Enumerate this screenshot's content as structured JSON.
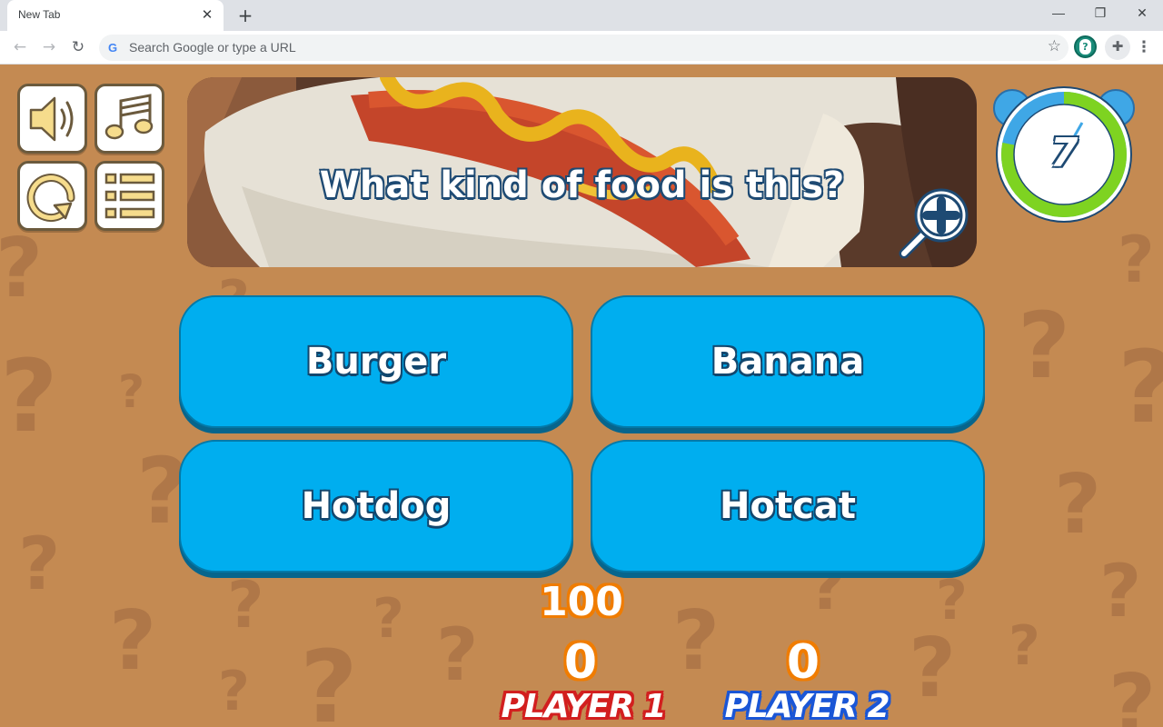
{
  "browser": {
    "tab_title": "New Tab",
    "tab_close": "✕",
    "new_tab": "+",
    "window_controls": {
      "minimize": "—",
      "restore": "❐",
      "close": "✕"
    },
    "nav": {
      "back": "←",
      "forward": "→",
      "reload": "↻"
    },
    "omnibox_placeholder": "Search Google or type a URL",
    "google_glyph": "G",
    "bookmark": "☆",
    "extensions": "✚",
    "menu": "⋮"
  },
  "controls": [
    {
      "icon": "speaker-icon"
    },
    {
      "icon": "music-note-icon"
    },
    {
      "icon": "restart-icon"
    },
    {
      "icon": "list-menu-icon"
    }
  ],
  "question": {
    "text": "What kind of food is this?",
    "image": "hotdog-photo"
  },
  "timer": {
    "value": "7",
    "remaining_fraction": 0.78
  },
  "answers": [
    {
      "label": "Burger"
    },
    {
      "label": "Banana"
    },
    {
      "label": "Hotdog"
    },
    {
      "label": "Hotcat"
    }
  ],
  "scoreboard": {
    "points_available": "100",
    "player1": {
      "score": "0",
      "name": "PLAYER 1"
    },
    "player2": {
      "score": "0",
      "name": "PLAYER 2"
    }
  },
  "colors": {
    "background": "#c48a52",
    "answer_button": "#00aeef",
    "timer_ring": "#7ed321",
    "player1": "#d21f1f",
    "player2": "#1a56d6",
    "score_outline": "#f07c00"
  }
}
